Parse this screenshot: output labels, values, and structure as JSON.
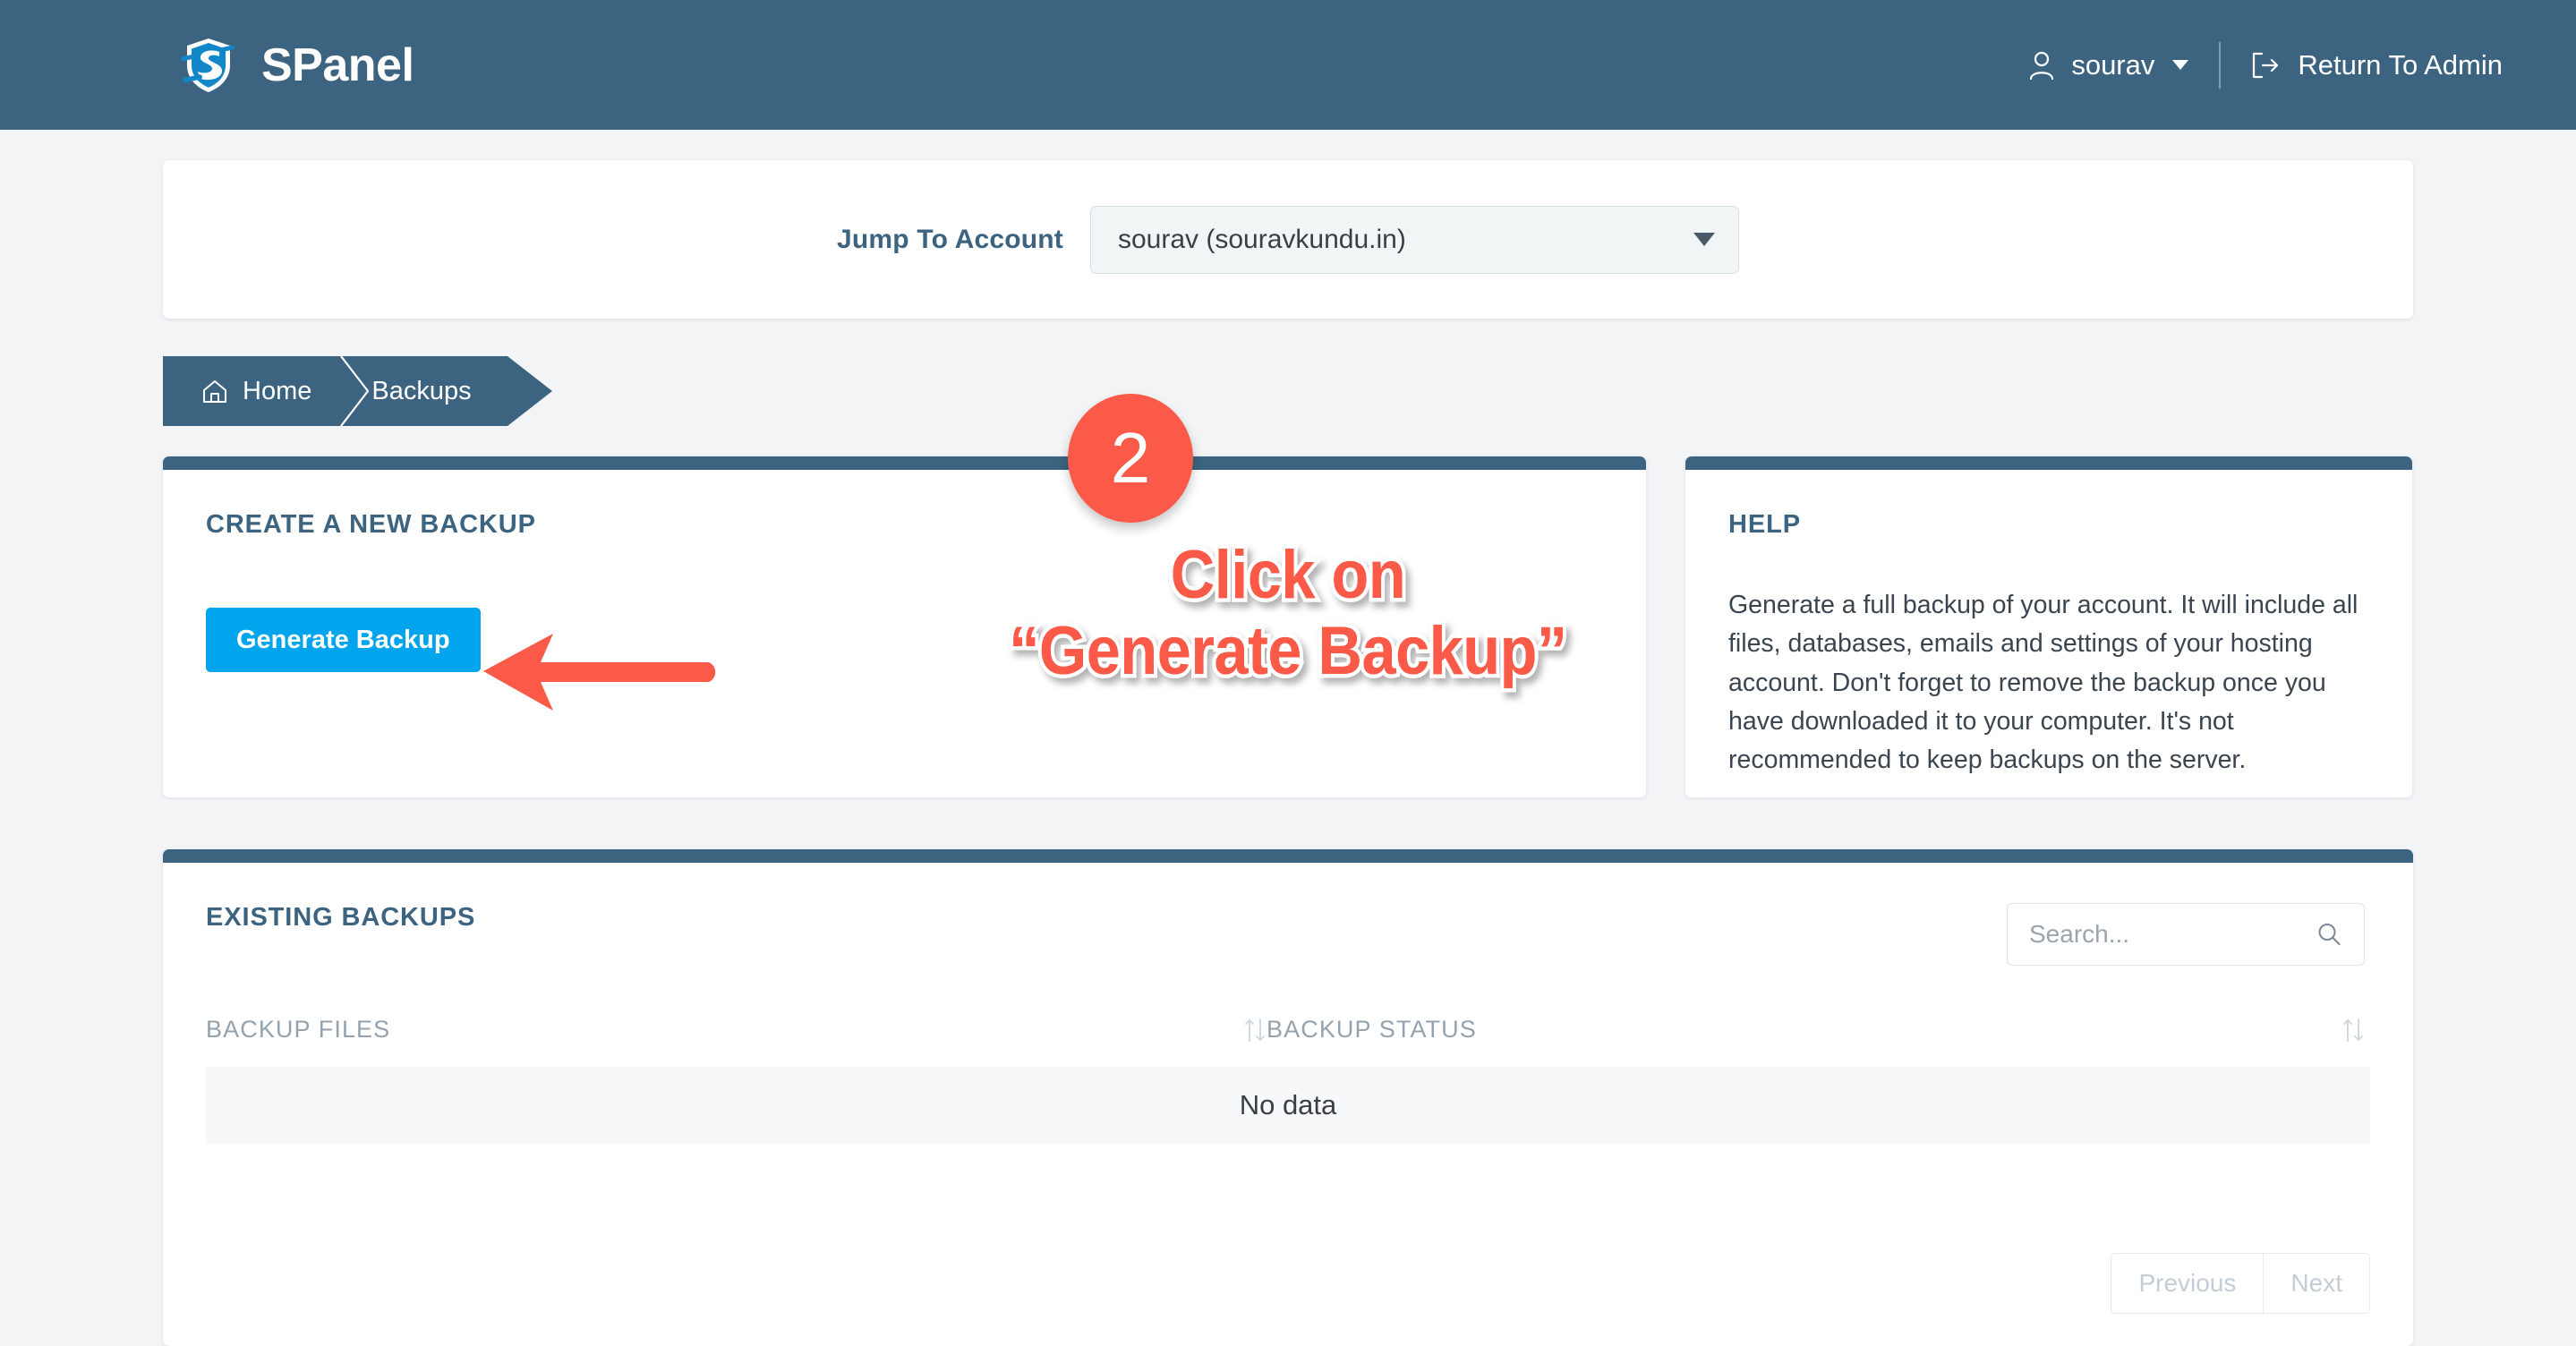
{
  "header": {
    "brand_name": "SPanel",
    "logo_icon": "spanel-shield-logo",
    "user_icon": "person-icon",
    "user_name": "sourav",
    "caret_icon": "caret-down-icon",
    "exit_icon": "exit-arrow-icon",
    "return_label": "Return To Admin"
  },
  "jump": {
    "label": "Jump To Account",
    "selected": "sourav (souravkundu.in)",
    "caret_icon": "caret-down-icon"
  },
  "breadcrumb": {
    "home_icon": "home-icon",
    "home": "Home",
    "current": "Backups"
  },
  "create_panel": {
    "title": "CREATE A NEW BACKUP",
    "button_label": "Generate Backup"
  },
  "help_panel": {
    "title": "HELP",
    "body": "Generate a full backup of your account. It will include all files, databases, emails and settings of your hosting account. Don't forget to remove the backup once you have downloaded it to your computer. It's not recommended to keep backups on the server."
  },
  "existing_panel": {
    "title": "EXISTING BACKUPS",
    "search_placeholder": "Search...",
    "search_value": "",
    "search_icon": "search-icon",
    "columns": [
      {
        "label": "BACKUP FILES",
        "sort_icon": "sort-updown-icon"
      },
      {
        "label": "BACKUP STATUS",
        "sort_icon": "sort-updown-icon"
      }
    ],
    "empty_text": "No data",
    "pagination": {
      "previous": "Previous",
      "next": "Next"
    }
  },
  "annotation": {
    "step_number": "2",
    "line1": "Click on",
    "line2": "“Generate Backup”",
    "arrow_icon": "left-arrow-annotation",
    "accent_color": "#fa5a47"
  },
  "colors": {
    "header_blue": "#3c6480",
    "button_blue": "#00a5ee",
    "annotation_red": "#fa5a47",
    "page_background": "#f2f4f6"
  }
}
